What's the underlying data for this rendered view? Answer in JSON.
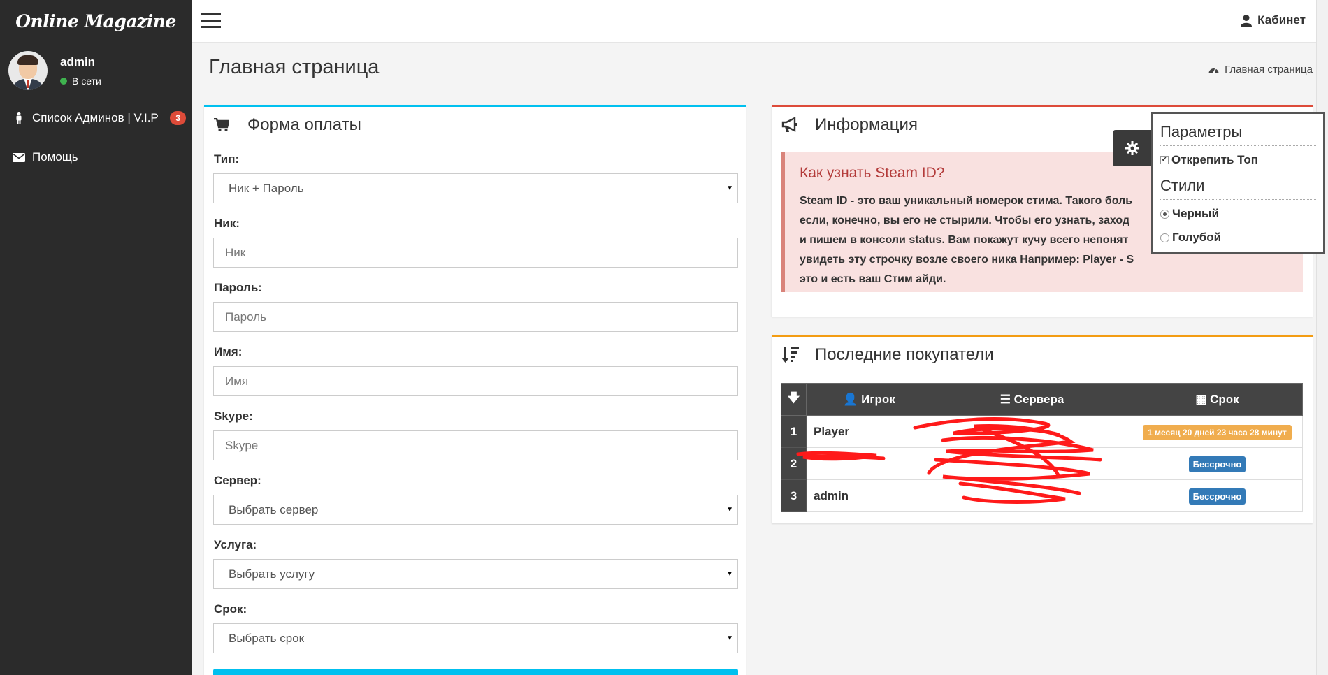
{
  "brand": "Online Magazine",
  "user": {
    "name": "admin",
    "status": "В сети"
  },
  "sidebar": {
    "items": [
      {
        "label": "Список Админов | V.I.P",
        "badge": "3",
        "icon": "male-icon"
      },
      {
        "label": "Помощь",
        "icon": "envelope-icon"
      }
    ]
  },
  "header": {
    "cabinet": "Кабинет"
  },
  "page": {
    "title": "Главная страница",
    "breadcrumb": "Главная страница"
  },
  "payment": {
    "title": "Форма оплаты",
    "type_label": "Тип:",
    "type_value": "Ник + Пароль",
    "nick_label": "Ник:",
    "nick_placeholder": "Ник",
    "password_label": "Пароль:",
    "password_placeholder": "Пароль",
    "name_label": "Имя:",
    "name_placeholder": "Имя",
    "skype_label": "Skype:",
    "skype_placeholder": "Skype",
    "server_label": "Сервер:",
    "server_value": "Выбрать сервер",
    "service_label": "Услуга:",
    "service_value": "Выбрать услугу",
    "term_label": "Срок:",
    "term_value": "Выбрать срок"
  },
  "info": {
    "title": "Информация",
    "callout_title": "Как узнать Steam ID?",
    "callout_text": "Steam ID - это ваш уникальный номерок стима. Такого боль\nесли, конечно, вы его не стырили. Чтобы его узнать, заход\nи пишем в консоли status. Вам покажут кучу всего непонят\nувидеть эту строчку возле своего ника Например: Player - S\nэто и есть ваш Стим айди."
  },
  "buyers": {
    "title": "Последние покупатели",
    "columns": [
      "Игрок",
      "Сервера",
      "Срок"
    ],
    "rows": [
      {
        "n": "1",
        "player": "Player",
        "term": "1 месяц 20 дней 23 часа 28 минут",
        "term_style": "orange"
      },
      {
        "n": "2",
        "player": "",
        "term": "Бессрочно",
        "term_style": "blue"
      },
      {
        "n": "3",
        "player": "admin",
        "term": "Бессрочно",
        "term_style": "blue"
      }
    ]
  },
  "settings": {
    "params_title": "Параметры",
    "pin_label": "Открепить Топ",
    "styles_title": "Стили",
    "black_label": "Черный",
    "blue_label": "Голубой"
  },
  "colors": {
    "sidebar": "#2b2b2b",
    "accent_blue": "#00c0ef",
    "accent_red": "#dd4b39",
    "accent_orange": "#f39c12",
    "scribble": "#ff0000"
  }
}
